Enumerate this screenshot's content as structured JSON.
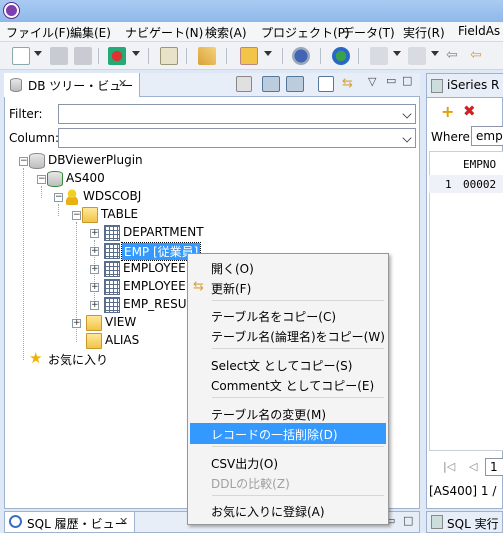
{
  "menubar": [
    "ファイル(F)",
    "編集(E)",
    "ナビゲート(N)",
    "検索(A)",
    "プロジェクト(P)",
    "データ(T)",
    "実行(R)",
    "FieldAs"
  ],
  "db_view": {
    "tab_title": "DB ツリー・ビュー",
    "filter_label": "Filter:",
    "column_label": "Column:",
    "tree": {
      "root": "DBViewerPlugin",
      "server": "AS400",
      "library": "WDSCOBJ",
      "table_folder": "TABLE",
      "tables": [
        "DEPARTMENT",
        "EMP [従業員]",
        "EMPLOYEE",
        "EMPLOYEE",
        "EMP_RESU"
      ],
      "view_folder": "VIEW",
      "alias_folder": "ALIAS",
      "favorites": "お気に入り"
    }
  },
  "right_view": {
    "tab_title": "iSeries R",
    "where_label": "Where:",
    "where_value": "emp",
    "col_header": "EMPNO",
    "row_num": "1",
    "row_val": "00002",
    "page_value": "1",
    "status": "[AS400] 1 /"
  },
  "bottom": {
    "sql_history_tab": "SQL 履歴・ビュー",
    "sql_exec_tab": "SQL 実行"
  },
  "context_menu": {
    "items": [
      "開く(O)",
      "更新(F)",
      "テーブル名をコピー(C)",
      "テーブル名(論理名)をコピー(W)",
      "Select文 としてコピー(S)",
      "Comment文 としてコピー(E)",
      "テーブル名の変更(M)",
      "レコードの一括削除(D)",
      "CSV出力(O)",
      "DDLの比較(Z)",
      "お気に入りに登録(A)"
    ]
  },
  "colors": {
    "highlight": "#3399ff",
    "title_bar": "#9dc3ef"
  }
}
